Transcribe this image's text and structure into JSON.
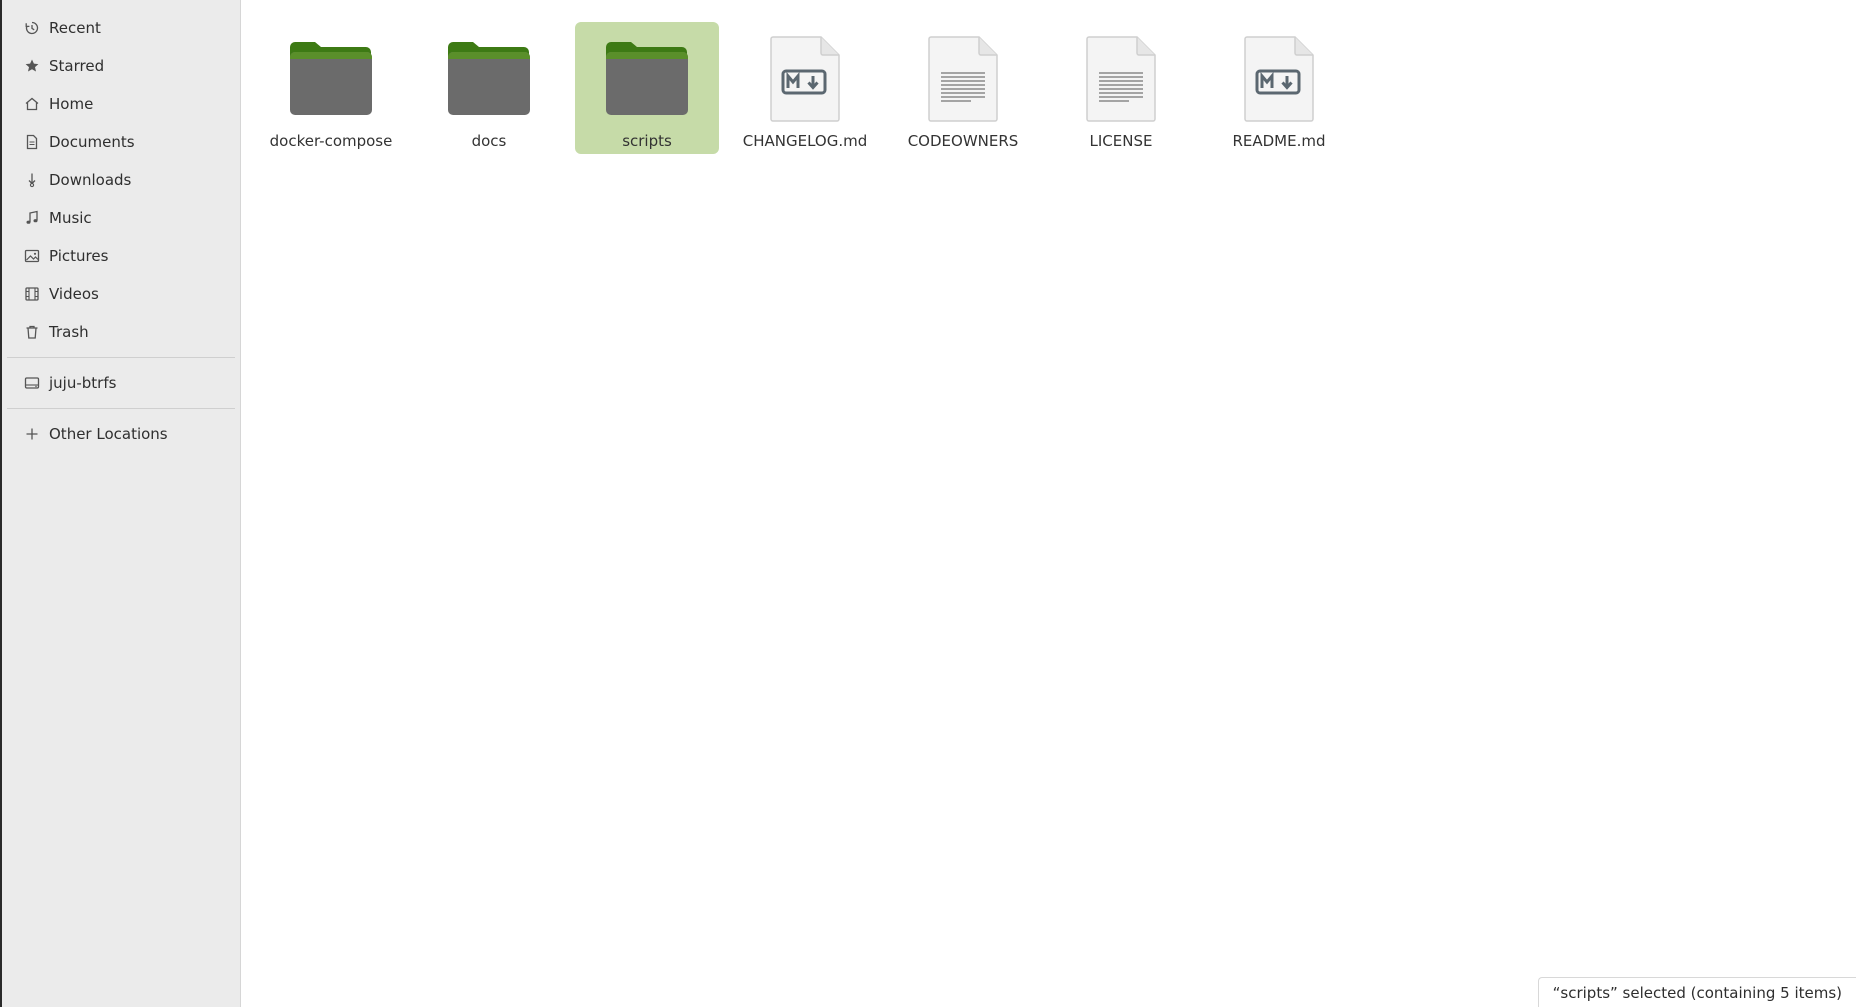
{
  "sidebar": {
    "items": [
      {
        "label": "Recent",
        "icon": "clock-icon"
      },
      {
        "label": "Starred",
        "icon": "star-icon"
      },
      {
        "label": "Home",
        "icon": "home-icon"
      },
      {
        "label": "Documents",
        "icon": "document-icon"
      },
      {
        "label": "Downloads",
        "icon": "download-icon"
      },
      {
        "label": "Music",
        "icon": "music-icon"
      },
      {
        "label": "Pictures",
        "icon": "picture-icon"
      },
      {
        "label": "Videos",
        "icon": "video-icon"
      },
      {
        "label": "Trash",
        "icon": "trash-icon"
      }
    ],
    "drives": [
      {
        "label": "juju-btrfs",
        "icon": "drive-icon"
      }
    ],
    "other": {
      "label": "Other Locations",
      "icon": "plus-icon"
    }
  },
  "files": [
    {
      "name": "docker-compose",
      "type": "folder",
      "selected": false
    },
    {
      "name": "docs",
      "type": "folder",
      "selected": false
    },
    {
      "name": "scripts",
      "type": "folder",
      "selected": true
    },
    {
      "name": "CHANGELOG.md",
      "type": "markdown",
      "selected": false
    },
    {
      "name": "CODEOWNERS",
      "type": "text",
      "selected": false
    },
    {
      "name": "LICENSE",
      "type": "text",
      "selected": false
    },
    {
      "name": "README.md",
      "type": "markdown",
      "selected": false
    }
  ],
  "status": {
    "text": "“scripts” selected  (containing 5 items)"
  },
  "colors": {
    "selection": "#c6dba8",
    "folder_tab": "#3d7a14",
    "folder_body": "#6b6b6b",
    "sidebar_bg": "#ebebeb"
  }
}
